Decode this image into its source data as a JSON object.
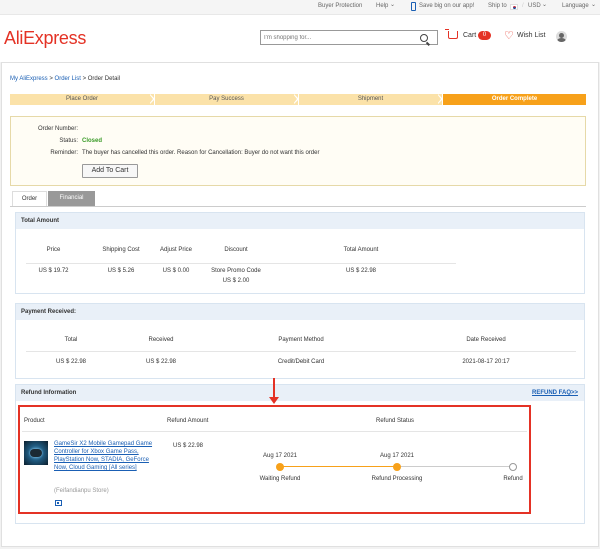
{
  "topbar": {
    "buyer_protection": "Buyer Protection",
    "help": "Help",
    "app_promo": "Save big on our app!",
    "ship_to": "Ship to",
    "currency": "USD",
    "language": "Language",
    "chevron": "⌄",
    "divider": "/"
  },
  "header": {
    "logo": "AliExpress",
    "search_placeholder": "I'm shopping for...",
    "cart_label": "Cart",
    "cart_count": "0",
    "wishlist_label": "Wish List"
  },
  "breadcrumb": {
    "item1": "My AliExpress",
    "sep": ">",
    "item2": "Order List",
    "item3": "Order Detail"
  },
  "steps": [
    {
      "label": "Place Order",
      "state": "done"
    },
    {
      "label": "Pay Success",
      "state": "done"
    },
    {
      "label": "Shipment",
      "state": "done"
    },
    {
      "label": "Order Complete",
      "state": "active"
    }
  ],
  "order_info": {
    "order_number_label": "Order Number:",
    "order_number_value": "",
    "status_label": "Status:",
    "status_value": "Closed",
    "reminder_label": "Reminder:",
    "reminder_value": "The buyer has cancelled this order. Reason for Cancellation: Buyer do not want this order",
    "add_to_cart": "Add To Cart"
  },
  "tabs": [
    {
      "label": "Order",
      "selected": false
    },
    {
      "label": "Financial",
      "selected": true
    }
  ],
  "total_amount": {
    "title": "Total Amount",
    "headers": [
      "Price",
      "Shipping Cost",
      "Adjust Price",
      "Discount",
      "Total Amount"
    ],
    "row": [
      "US $ 19.72",
      "US $ 5.26",
      "US $ 0.00",
      "Store Promo Code",
      "US $ 22.98"
    ],
    "discount_amount": "US $ 2.00"
  },
  "payment_received": {
    "title": "Payment Received:",
    "headers": [
      "Total",
      "Received",
      "Payment Method",
      "Date Received"
    ],
    "row": [
      "US $ 22.98",
      "US $ 22.98",
      "Credit/Debit Card",
      "2021-08-17 20:17"
    ]
  },
  "refund": {
    "title": "Refund Information",
    "faq_link": "REFUND FAQ>>",
    "headers": [
      "Product",
      "Refund Amount",
      "Refund Status"
    ],
    "product_title": "GameSir X2 Mobile Gamepad Game Controller for Xbox Game Pass, PlayStation Now, STADIA, GeForce Now, Cloud Gaming [All series]",
    "store": "(Feifandianpu Store)",
    "refund_amount": "US $ 22.98",
    "timeline": [
      {
        "date": "Aug 17 2021",
        "label": "Waiting Refund",
        "done": true
      },
      {
        "date": "Aug 17 2021",
        "label": "Refund Processing",
        "done": true
      },
      {
        "date": "",
        "label": "Refund",
        "done": false
      }
    ]
  },
  "colors": {
    "brand": "#e43225",
    "accent_orange": "#f7a11a",
    "link_blue": "#1a5fb4",
    "status_green": "#3a9b28"
  }
}
